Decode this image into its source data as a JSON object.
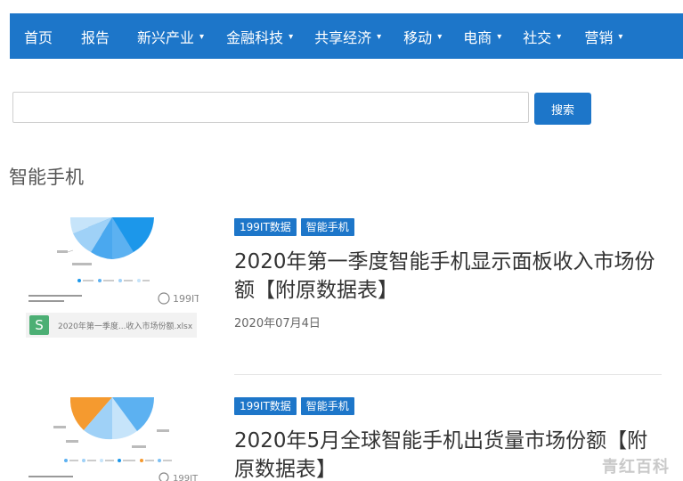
{
  "nav": {
    "items": [
      {
        "label": "首页",
        "dropdown": false
      },
      {
        "label": "报告",
        "dropdown": false
      },
      {
        "label": "新兴产业",
        "dropdown": true
      },
      {
        "label": "金融科技",
        "dropdown": true
      },
      {
        "label": "共享经济",
        "dropdown": true
      },
      {
        "label": "移动",
        "dropdown": true
      },
      {
        "label": "电商",
        "dropdown": true
      },
      {
        "label": "社交",
        "dropdown": true
      },
      {
        "label": "营销",
        "dropdown": true
      }
    ],
    "chevron": "▾"
  },
  "search": {
    "value": "",
    "placeholder": "",
    "button_label": "搜索"
  },
  "section": {
    "title": "智能手机"
  },
  "articles": [
    {
      "tags": [
        "199IT数据",
        "智能手机"
      ],
      "title": "2020年第一季度智能手机显示面板收入市场份额【附原数据表】",
      "date": "2020年07月4日",
      "thumbnail": {
        "file_icon": "S",
        "file_name": "2020年第一季度...收入市场份额.xlsx",
        "logo": "199IT"
      }
    },
    {
      "tags": [
        "199IT数据",
        "智能手机"
      ],
      "title": "2020年5月全球智能手机出货量市场份额【附原数据表】",
      "date": "",
      "thumbnail": {
        "logo": "199IT"
      }
    }
  ],
  "watermark": "青红百科",
  "colors": {
    "brand": "#1d76c9",
    "pie_light": "#9fd1f7",
    "pie_mid": "#5cb1f1",
    "pie_dark": "#1c97ea",
    "pie_orange": "#f59a2f"
  }
}
